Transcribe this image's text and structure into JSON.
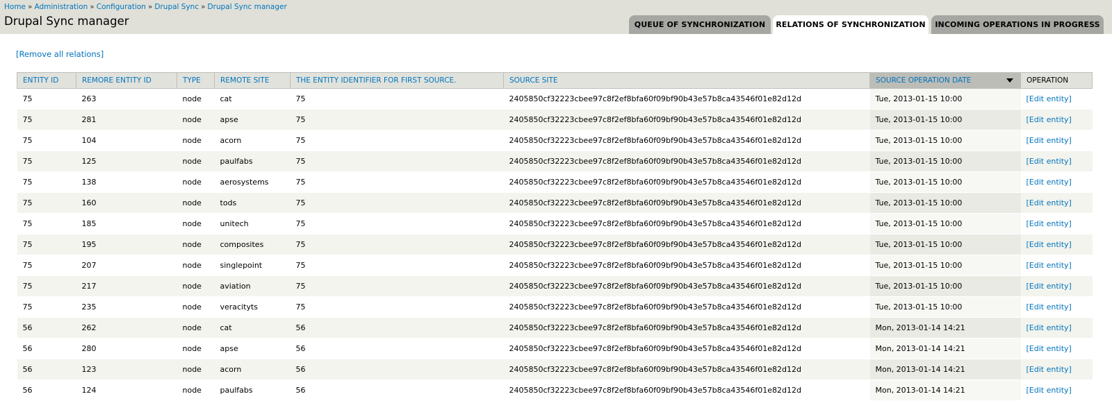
{
  "breadcrumb": [
    "Home",
    "Administration",
    "Configuration",
    "Drupal Sync",
    "Drupal Sync manager"
  ],
  "breadcrumb_separator": "»",
  "page_title": "Drupal Sync manager",
  "tabs": [
    {
      "label": "QUEUE OF SYNCHRONIZATION",
      "active": false
    },
    {
      "label": "RELATIONS OF SYNCHRONIZATION",
      "active": true
    },
    {
      "label": "INCOMING OPERATIONS IN PROGRESS",
      "active": false
    }
  ],
  "remove_link": "[Remove all relations]",
  "table": {
    "headers": [
      "ENTITY ID",
      "REMORE ENTITY ID",
      "TYPE",
      "REMOTE SITE",
      "THE ENTITY IDENTIFIER FOR FIRST SOURCE.",
      "SOURCE SITE",
      "SOURCE OPERATION DATE",
      "OPERATION"
    ],
    "sorted_column": 6,
    "rows": [
      [
        "75",
        "263",
        "node",
        "cat",
        "75",
        "2405850cf32223cbee97c8f2ef8bfa60f09bf90b43e57b8ca43546f01e82d12d",
        "Tue, 2013-01-15 10:00",
        "[Edit entity]"
      ],
      [
        "75",
        "281",
        "node",
        "apse",
        "75",
        "2405850cf32223cbee97c8f2ef8bfa60f09bf90b43e57b8ca43546f01e82d12d",
        "Tue, 2013-01-15 10:00",
        "[Edit entity]"
      ],
      [
        "75",
        "104",
        "node",
        "acorn",
        "75",
        "2405850cf32223cbee97c8f2ef8bfa60f09bf90b43e57b8ca43546f01e82d12d",
        "Tue, 2013-01-15 10:00",
        "[Edit entity]"
      ],
      [
        "75",
        "125",
        "node",
        "paulfabs",
        "75",
        "2405850cf32223cbee97c8f2ef8bfa60f09bf90b43e57b8ca43546f01e82d12d",
        "Tue, 2013-01-15 10:00",
        "[Edit entity]"
      ],
      [
        "75",
        "138",
        "node",
        "aerosystems",
        "75",
        "2405850cf32223cbee97c8f2ef8bfa60f09bf90b43e57b8ca43546f01e82d12d",
        "Tue, 2013-01-15 10:00",
        "[Edit entity]"
      ],
      [
        "75",
        "160",
        "node",
        "tods",
        "75",
        "2405850cf32223cbee97c8f2ef8bfa60f09bf90b43e57b8ca43546f01e82d12d",
        "Tue, 2013-01-15 10:00",
        "[Edit entity]"
      ],
      [
        "75",
        "185",
        "node",
        "unitech",
        "75",
        "2405850cf32223cbee97c8f2ef8bfa60f09bf90b43e57b8ca43546f01e82d12d",
        "Tue, 2013-01-15 10:00",
        "[Edit entity]"
      ],
      [
        "75",
        "195",
        "node",
        "composites",
        "75",
        "2405850cf32223cbee97c8f2ef8bfa60f09bf90b43e57b8ca43546f01e82d12d",
        "Tue, 2013-01-15 10:00",
        "[Edit entity]"
      ],
      [
        "75",
        "207",
        "node",
        "singlepoint",
        "75",
        "2405850cf32223cbee97c8f2ef8bfa60f09bf90b43e57b8ca43546f01e82d12d",
        "Tue, 2013-01-15 10:00",
        "[Edit entity]"
      ],
      [
        "75",
        "217",
        "node",
        "aviation",
        "75",
        "2405850cf32223cbee97c8f2ef8bfa60f09bf90b43e57b8ca43546f01e82d12d",
        "Tue, 2013-01-15 10:00",
        "[Edit entity]"
      ],
      [
        "75",
        "235",
        "node",
        "veracityts",
        "75",
        "2405850cf32223cbee97c8f2ef8bfa60f09bf90b43e57b8ca43546f01e82d12d",
        "Tue, 2013-01-15 10:00",
        "[Edit entity]"
      ],
      [
        "56",
        "262",
        "node",
        "cat",
        "56",
        "2405850cf32223cbee97c8f2ef8bfa60f09bf90b43e57b8ca43546f01e82d12d",
        "Mon, 2013-01-14 14:21",
        "[Edit entity]"
      ],
      [
        "56",
        "280",
        "node",
        "apse",
        "56",
        "2405850cf32223cbee97c8f2ef8bfa60f09bf90b43e57b8ca43546f01e82d12d",
        "Mon, 2013-01-14 14:21",
        "[Edit entity]"
      ],
      [
        "56",
        "123",
        "node",
        "acorn",
        "56",
        "2405850cf32223cbee97c8f2ef8bfa60f09bf90b43e57b8ca43546f01e82d12d",
        "Mon, 2013-01-14 14:21",
        "[Edit entity]"
      ],
      [
        "56",
        "124",
        "node",
        "paulfabs",
        "56",
        "2405850cf32223cbee97c8f2ef8bfa60f09bf90b43e57b8ca43546f01e82d12d",
        "Mon, 2013-01-14 14:21",
        "[Edit entity]"
      ]
    ]
  },
  "colors": {
    "link": "#0074bd",
    "header_band": "#e0e0d8",
    "tab_inactive": "#a6a7a2",
    "sorted_header": "#bdbdb8"
  },
  "icons": {
    "sort_indicator": "sort-desc-icon"
  }
}
